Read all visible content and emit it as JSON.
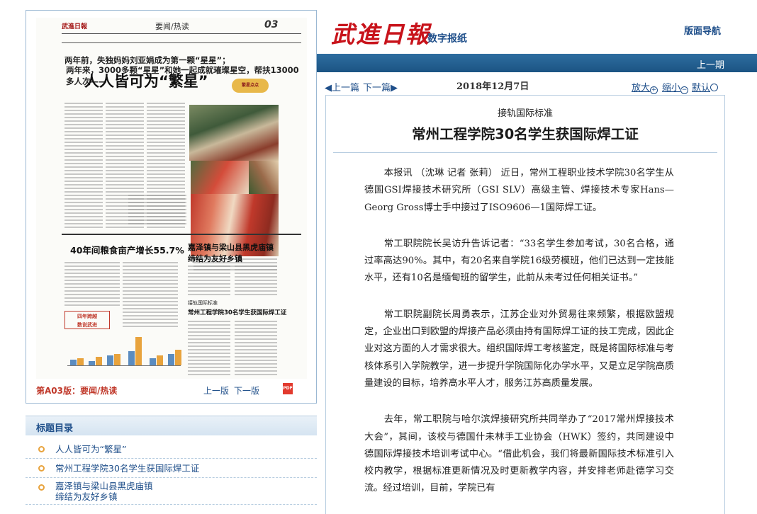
{
  "header": {
    "logo_text": "武進日報",
    "subtitle": "数字报纸",
    "nav_label": "版面导航",
    "prev_issue": "上一期"
  },
  "toolbar": {
    "prev_page": "◀上一篇",
    "next_page": "下一篇▶",
    "date": "2018年12月7日",
    "zoom_in": "放大",
    "zoom_out": "缩小",
    "default": "默认"
  },
  "article": {
    "pre_title": "接轨国际标准",
    "title": "常州工程学院30名学生获国际焊工证",
    "paragraphs": [
      "本报讯 （沈琳 记者 张莉） 近日，常州工程职业技术学院30名学生从德国GSI焊接技术研究所（GSI SLV）高级主管、焊接技术专家Hans—Georg Gross博士手中接过了ISO9606—1国际焊工证。",
      "常工职院院长吴访升告诉记者：“33名学生参加考试，30名合格，通过率高达90%。其中，有20名来自学院16级劳模班，他们已达到一定技能水平，还有10名是缅甸班的留学生，此前从未考过任何相关证书。”",
      "常工职院副院长周勇表示，江苏企业对外贸易往来频繁，根据欧盟规定，企业出口到欧盟的焊接产品必须由持有国际焊工证的技工完成，因此企业对这方面的人才需求很大。组织国际焊工考核鉴定，既是将国际标准与考核体系引入学院教学，进一步提升学院国际化办学水平，又是立足学院高质量建设的目标，培养高水平人才，服务江苏高质量发展。",
      "去年，常工职院与哈尔滨焊接研究所共同举办了“2017常州焊接技术大会”，其间，该校与德国什未林手工业协会（HWK）签约，共同建设中德国际焊接技术培训考试中心。“借此机会，我们将最新国际技术标准引入校内教学，根据标准更新情况及时更新教学内容，并安排老师赴德学习交流。经过培训，目前，学院已有"
    ]
  },
  "newspaper": {
    "masthead": "武進日報",
    "section": "要闻/热读",
    "page_num": "03",
    "kicker1": "两年前，失独妈妈刘亚娟成为第一颗“星星”；",
    "kicker2": "两年来，3000多颗“星星”和她一起成就璀璨星空，帮扶13000多人次——",
    "headline": "人人皆可为“繁星”",
    "logo_badge": "繁星点点",
    "grain_title": "40年间粮食亩产增长55.7%",
    "town_title1": "嘉泽镇与梁山县黑虎庙镇",
    "town_title2": "缔结为友好乡镇",
    "weld_pre": "接轨国际标准",
    "weld_title": "常州工程学院30名学生获国际焊工证",
    "badge_text": "四年跨越\n数说武进",
    "footer_label": "第A03版：要闻/热读",
    "prev_page": "上一版",
    "next_page": "下一版"
  },
  "title_list": {
    "heading": "标题目录",
    "items": [
      "人人皆可为“繁星”",
      "常州工程学院30名学生获国际焊工证",
      "嘉泽镇与梁山县黑虎庙镇\n缔结为友好乡镇"
    ]
  },
  "colors": {
    "brand_red": "#c8131b",
    "link_blue": "#1f4f8a",
    "bar_blue": "#1b5483",
    "accent_orange": "#e8a33d"
  }
}
